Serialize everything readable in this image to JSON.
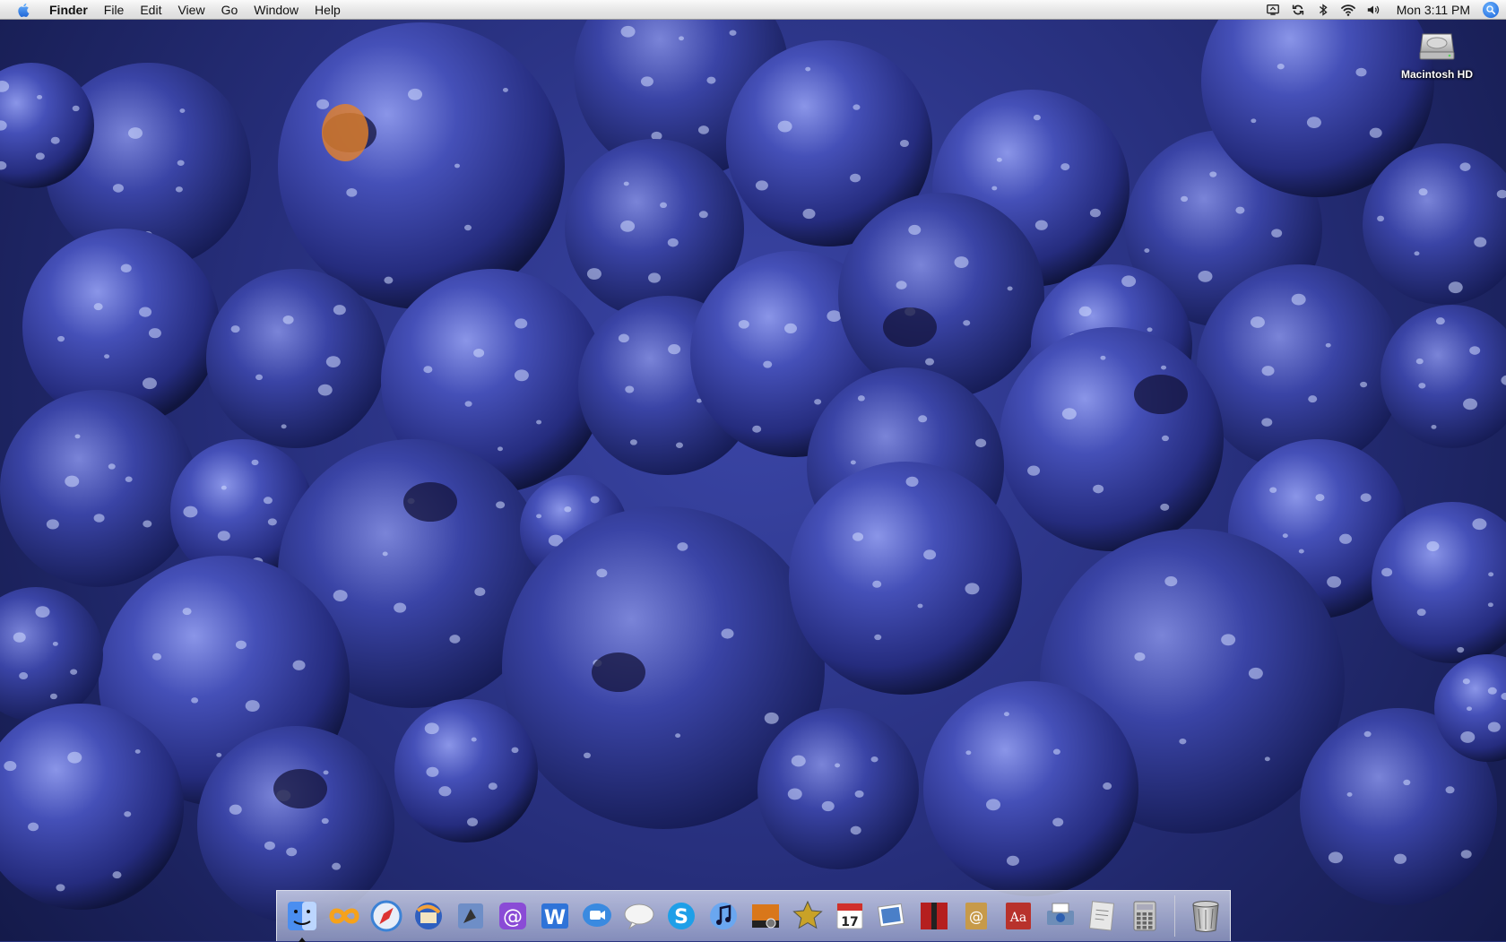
{
  "menubar": {
    "apple_icon": "apple-icon",
    "app_name": "Finder",
    "items": [
      {
        "label": "File"
      },
      {
        "label": "Edit"
      },
      {
        "label": "View"
      },
      {
        "label": "Go"
      },
      {
        "label": "Window"
      },
      {
        "label": "Help"
      }
    ],
    "status_icons": [
      "display-icon",
      "sync-icon",
      "bluetooth-icon",
      "wifi-icon",
      "volume-icon"
    ],
    "clock": "Mon 3:11 PM",
    "spotlight_icon": "spotlight-icon"
  },
  "desktop": {
    "wallpaper": "blueberries-wallpaper",
    "icons": [
      {
        "label": "Macintosh HD",
        "icon": "hard-drive-icon"
      }
    ]
  },
  "dock": {
    "items": [
      {
        "name": "finder",
        "icon": "finder-icon",
        "running": true,
        "color": "#4a8ef0"
      },
      {
        "name": "onedrive",
        "icon": "loop-icon",
        "running": false,
        "color": "#f6a21b"
      },
      {
        "name": "safari",
        "icon": "compass-icon",
        "running": false,
        "color": "#3b82d6"
      },
      {
        "name": "thunderbird",
        "icon": "mail-bird-icon",
        "running": false,
        "color": "#2f5fbf"
      },
      {
        "name": "bird-app",
        "icon": "bird-icon",
        "running": false,
        "color": "#6e8ec7"
      },
      {
        "name": "at-app",
        "icon": "at-sign-icon",
        "running": false,
        "color": "#8a4bd6"
      },
      {
        "name": "word-app",
        "icon": "w-letter-icon",
        "running": false,
        "color": "#2f73d8"
      },
      {
        "name": "video-chat",
        "icon": "camera-bubble-icon",
        "running": false,
        "color": "#3a8ae0"
      },
      {
        "name": "speech-app",
        "icon": "speech-bubble-icon",
        "running": false,
        "color": "#f4f4f4"
      },
      {
        "name": "skype",
        "icon": "skype-icon",
        "running": false,
        "color": "#1e9fe8"
      },
      {
        "name": "itunes",
        "icon": "music-note-icon",
        "running": false,
        "color": "#6aa7f0"
      },
      {
        "name": "photo-booth",
        "icon": "photo-camera-icon",
        "running": false,
        "color": "#d9771a"
      },
      {
        "name": "imovie",
        "icon": "star-icon",
        "running": false,
        "color": "#c9a227"
      },
      {
        "name": "ical",
        "icon": "calendar-icon",
        "running": false,
        "color": "#d0302b",
        "badge_text": "17"
      },
      {
        "name": "preview",
        "icon": "photos-icon",
        "running": false,
        "color": "#4a7fc8"
      },
      {
        "name": "front-row",
        "icon": "theater-icon",
        "running": false,
        "color": "#b51f1f"
      },
      {
        "name": "address-book",
        "icon": "address-book-icon",
        "running": false,
        "color": "#c79a4a"
      },
      {
        "name": "dictionary",
        "icon": "dictionary-icon",
        "running": false,
        "color": "#b8322c"
      },
      {
        "name": "hp-utility",
        "icon": "printer-icon",
        "running": false,
        "color": "#6d8db8"
      },
      {
        "name": "grocery-list",
        "icon": "notes-icon",
        "running": false,
        "color": "#e7e7e7"
      },
      {
        "name": "calculator",
        "icon": "calculator-icon",
        "running": false,
        "color": "#c8c8c8"
      }
    ],
    "trash": {
      "name": "trash",
      "icon": "trash-icon"
    }
  }
}
